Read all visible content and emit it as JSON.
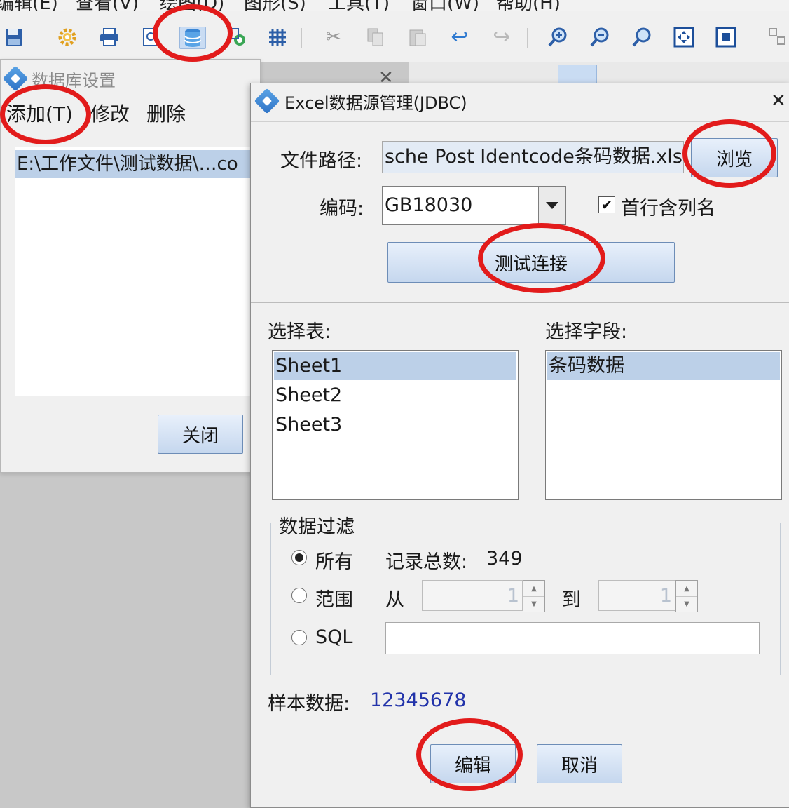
{
  "menubar": {
    "items": [
      "编辑(E)",
      "查看(V)",
      "绘图(D)",
      "图形(S)",
      "工具(T)",
      "窗口(W)",
      "帮助(H)"
    ]
  },
  "toolbar": {
    "icons": [
      "save-icon",
      "settings-icon",
      "print-icon",
      "preview-icon",
      "database-icon",
      "picture-icon",
      "grid-icon",
      "cut-icon",
      "copy-icon",
      "paste-icon",
      "undo-icon",
      "redo-icon",
      "zoom-in-icon",
      "zoom-out-icon",
      "zoom-icon",
      "fit-page-icon",
      "fit-window-icon",
      "group-icon"
    ]
  },
  "db_settings": {
    "title": "数据库设置",
    "menu": {
      "add": "添加(T)",
      "modify": "修改",
      "delete": "删除"
    },
    "entry": "E:\\工作文件\\测试数据\\…co",
    "close_label": "关闭"
  },
  "jdbc_dialog": {
    "title": "Excel数据源管理(JDBC)",
    "close_glyph": "✕",
    "file_path": {
      "label": "文件路径:",
      "value": "sche Post Identcode条码数据.xlsx",
      "browse_label": "浏览"
    },
    "encoding": {
      "label": "编码:",
      "value": "GB18030",
      "header_row_label": "首行含列名",
      "header_row_checked": true
    },
    "test_connection_label": "测试连接",
    "select_table": {
      "label": "选择表:",
      "items": [
        "Sheet1",
        "Sheet2",
        "Sheet3"
      ],
      "selected": "Sheet1"
    },
    "select_field": {
      "label": "选择字段:",
      "items": [
        "条码数据"
      ],
      "selected": "条码数据"
    },
    "data_filter": {
      "label": "数据过滤",
      "all_label": "所有",
      "total_label": "记录总数:",
      "total_value": "349",
      "range_label": "范围",
      "from_label": "从",
      "from_value": "1",
      "to_label": "到",
      "to_value": "1",
      "sql_label": "SQL",
      "sql_value": "",
      "selected_mode": "所有"
    },
    "sample": {
      "label": "样本数据:",
      "value": "12345678"
    },
    "edit_label": "编辑",
    "cancel_label": "取消"
  },
  "colors": {
    "annotation": "#e21b1b",
    "selection": "#bcd0e8",
    "sample_value": "#2233aa"
  }
}
